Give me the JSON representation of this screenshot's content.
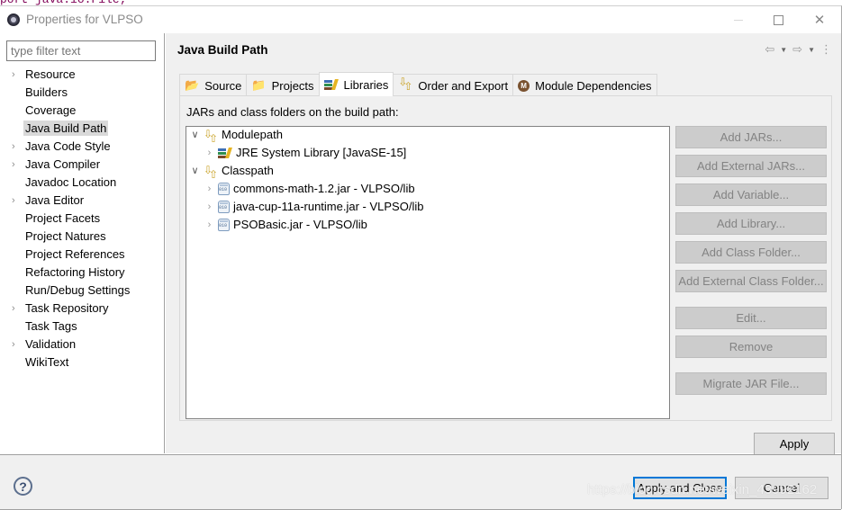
{
  "background_code_fragment": "port java.io.File;",
  "window": {
    "title": "Properties for VLPSO",
    "controls": {
      "minimize": "minimize",
      "maximize": "maximize",
      "close": "close"
    }
  },
  "sidebar": {
    "filter_placeholder": "type filter text",
    "items": [
      {
        "label": "Resource",
        "expandable": true
      },
      {
        "label": "Builders",
        "expandable": false
      },
      {
        "label": "Coverage",
        "expandable": false
      },
      {
        "label": "Java Build Path",
        "expandable": false,
        "selected": true
      },
      {
        "label": "Java Code Style",
        "expandable": true
      },
      {
        "label": "Java Compiler",
        "expandable": true
      },
      {
        "label": "Javadoc Location",
        "expandable": false
      },
      {
        "label": "Java Editor",
        "expandable": true
      },
      {
        "label": "Project Facets",
        "expandable": false
      },
      {
        "label": "Project Natures",
        "expandable": false
      },
      {
        "label": "Project References",
        "expandable": false
      },
      {
        "label": "Refactoring History",
        "expandable": false
      },
      {
        "label": "Run/Debug Settings",
        "expandable": false
      },
      {
        "label": "Task Repository",
        "expandable": true
      },
      {
        "label": "Task Tags",
        "expandable": false
      },
      {
        "label": "Validation",
        "expandable": true
      },
      {
        "label": "WikiText",
        "expandable": false
      }
    ]
  },
  "page": {
    "title": "Java Build Path",
    "nav": {
      "back": "back-arrow",
      "forward": "forward-arrow",
      "menu": "more-options"
    }
  },
  "tabs": [
    {
      "label": "Source",
      "icon": "source-folder-icon"
    },
    {
      "label": "Projects",
      "icon": "projects-folder-icon"
    },
    {
      "label": "Libraries",
      "icon": "libraries-icon",
      "active": true
    },
    {
      "label": "Order and Export",
      "icon": "order-export-icon"
    },
    {
      "label": "Module Dependencies",
      "icon": "module-icon"
    }
  ],
  "libraries": {
    "label": "JARs and class folders on the build path:",
    "tree": {
      "modulepath": {
        "label": "Modulepath",
        "children": [
          {
            "label": "JRE System Library [JavaSE-15]"
          }
        ]
      },
      "classpath": {
        "label": "Classpath",
        "children": [
          {
            "label": "commons-math-1.2.jar - VLPSO/lib"
          },
          {
            "label": "java-cup-11a-runtime.jar - VLPSO/lib"
          },
          {
            "label": "PSOBasic.jar - VLPSO/lib"
          }
        ]
      }
    },
    "buttons": {
      "add_jars": "Add JARs...",
      "add_external_jars": "Add External JARs...",
      "add_variable": "Add Variable...",
      "add_library": "Add Library...",
      "add_class_folder": "Add Class Folder...",
      "add_external_class_folder": "Add External Class Folder...",
      "edit": "Edit...",
      "remove": "Remove",
      "migrate_jar": "Migrate JAR File..."
    }
  },
  "apply_label": "Apply",
  "footer": {
    "help": "?",
    "apply_and_close": "Apply and Close",
    "cancel": "Cancel"
  },
  "watermark": "https://blog.csdn.net/weixin_43992162"
}
